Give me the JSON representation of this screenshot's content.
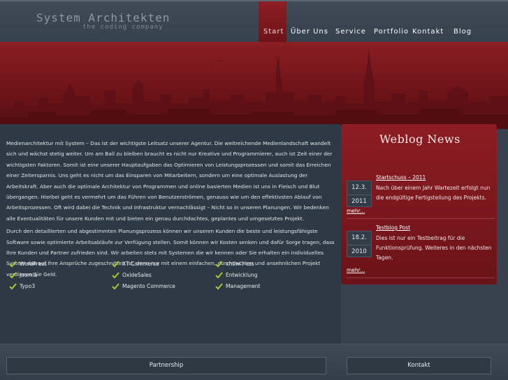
{
  "header": {
    "title": "System Architekten",
    "subtitle": "the coding company"
  },
  "nav": {
    "items": [
      {
        "label": "Start",
        "active": true
      },
      {
        "label": "Über Uns",
        "active": false
      },
      {
        "label": "Service",
        "active": false
      },
      {
        "label": "Portfolio",
        "active": false
      },
      {
        "label": "Kontakt",
        "active": false
      },
      {
        "label": "Blog",
        "active": false
      }
    ]
  },
  "main": {
    "paragraphs": [
      "Medienarchitektur mit System – Das ist der wichtigste Leitsatz unserer Agentur. Die weitreichende Medienlandschaft wandelt sich und wächst stetig weiter. Um am Ball zu bleiben braucht es nicht nur Kreative und Programmierer, auch ist Zeit einer der wichtigsten Faktoren. Somit ist eine unserer Hauptaufgaben das Optimieren von Leistungsprozessen und somit das Erreichen einer Zeitersparnis. Uns geht es nicht um das Einsparen von Mitarbeitern, sondern um eine optimale Auslastung der Arbeitskraft. Aber auch die optimale Architektur von Programmen und online basierten Medien ist uns in Fleisch und Blut übergangen. Hierbei geht es vermehrt um das Führen von Benutzerströmen, genauso wie um den effektivsten Ablauf von Arbeitsprozessen. Oft wird dabei die Technik und Infrastruktur vernachlässigt – Nicht so in unseren Planungen. Wir bedenken alle Eventualitäten für unsere Kunden mit und bieten ein genau durchdachtes, geplantes und umgesetztes Projekt.",
      "Durch den detaillierten und abgestimmten Planungsprozess können wir unseren Kunden die beste und leistungsfähigste Software sowie optimierte Arbeitsabläufe zur Verfügung stellen. Somit können wir Kosten senken und dafür Sorge tragen, dass Ihre Kunden und Partner zufrieden sind. Wir arbeiten stets mit Systemen die wir kennen oder Sie erhalten ein individuelles System das auf Ihre Ansprüche zugeschnitten ist, denn nur mit einem einfachen, durchdachten und ansehnlichen Projekt verdienen Sie Geld."
    ],
    "features": [
      [
        "WordPress",
        "XT Commerce",
        "xhtml / css"
      ],
      [
        "Joomla",
        "OxideSales",
        "Entwicklung"
      ],
      [
        "Typo3",
        "Magento Commerce",
        "Management"
      ]
    ]
  },
  "weblog": {
    "title": "Weblog News",
    "posts": [
      {
        "day": "12.3.",
        "year": "2011",
        "title": "Startschuss – 2011",
        "text": "Nach über einem Jahr Wartezeit erfolgt nun die endgültige Fertigstellung des Projekts.",
        "more": "mehr..."
      },
      {
        "day": "18.2.",
        "year": "2010",
        "title": "Testblog Post",
        "text": "Dies ist nur ein Testbeitrag für die Funktionsprüfung. Weiteres in den nächsten Tagen.",
        "more": "mehr..."
      }
    ]
  },
  "footer": {
    "partnership": "Partnership",
    "kontakt": "Kontakt"
  },
  "colors": {
    "accent_red": "#7a1a20",
    "background": "#36434f",
    "check_green": "#a8c832"
  }
}
